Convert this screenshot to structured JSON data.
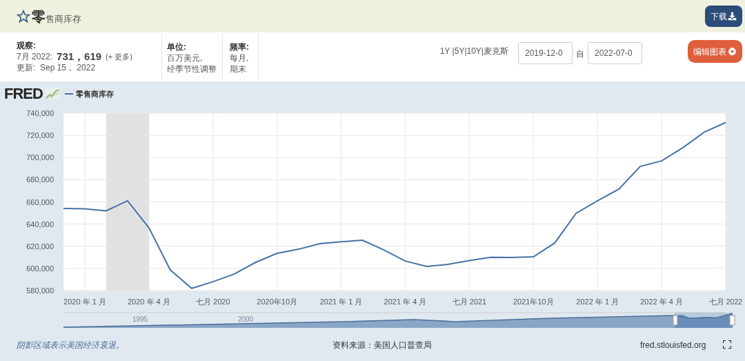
{
  "header": {
    "title_big": "零",
    "title_rest": "售商库存",
    "starred": false,
    "download_button": "下载"
  },
  "info": {
    "observation_label": "观察:",
    "observation_date": "7月 2022:",
    "observation_value": "731，619",
    "more_link": "(+ 更多)",
    "updated": "更新:  Sep 15， 2022",
    "units_label": "单位:",
    "units_lines": [
      "百万美元,",
      "经季节性调整"
    ],
    "frequency_label": "频率:",
    "frequency_lines": [
      "每月,",
      "期末"
    ]
  },
  "range_links": "1Y |5Y|10Y|麦克斯",
  "start_date": "2019-12-0",
  "date_separator": "自",
  "end_date": "2022-07-0",
  "edit_button": "编辑图表",
  "chart": {
    "logo": "FRED",
    "chart_data": {
      "type": "line",
      "grid": true,
      "categories": [
        null,
        "2020 年 1 月",
        null,
        null,
        "2020 年 4 月",
        null,
        null,
        "七月 2020",
        null,
        null,
        "2020年10月",
        null,
        null,
        "2021 年 1 月",
        null,
        null,
        "2021 年 4 月",
        null,
        null,
        "七月 2021",
        null,
        null,
        "2021年10月",
        null,
        null,
        "2022 年 1 月",
        null,
        null,
        "2022 年 4 月",
        null,
        null,
        "七月 2022"
      ],
      "series": [
        {
          "name": "零售商库存",
          "color": "#4572a7",
          "values": [
            654100,
            653800,
            652000,
            661000,
            636600,
            598700,
            582000,
            588000,
            595000,
            605500,
            613600,
            617300,
            622300,
            624000,
            625400,
            616700,
            606700,
            601800,
            603600,
            607000,
            610000,
            609800,
            610500,
            623000,
            649800,
            661000,
            671500,
            692000,
            697000,
            709000,
            723000,
            731600
          ]
        }
      ],
      "ylim": [
        580000,
        740000
      ],
      "yticks": [
        {
          "value": 580000,
          "label": "580,000"
        },
        {
          "value": 600000,
          "label": "600,000"
        },
        {
          "value": 620000,
          "label": "620,000"
        },
        {
          "value": 640000,
          "label": "640,000"
        },
        {
          "value": 660000,
          "label": "660,000"
        },
        {
          "value": 680000,
          "label": "680,000"
        },
        {
          "value": 700000,
          "label": "700,000"
        },
        {
          "value": 720000,
          "label": "720,000"
        },
        {
          "value": 740000,
          "label": "740,000"
        }
      ]
    },
    "navigator_years": [
      "1995",
      "2000"
    ]
  },
  "footer": {
    "note": "阴影区域表示美国经济衰退。",
    "source": "资料来源：美国人口普查局",
    "site": "fred.stlouisfed.org"
  }
}
